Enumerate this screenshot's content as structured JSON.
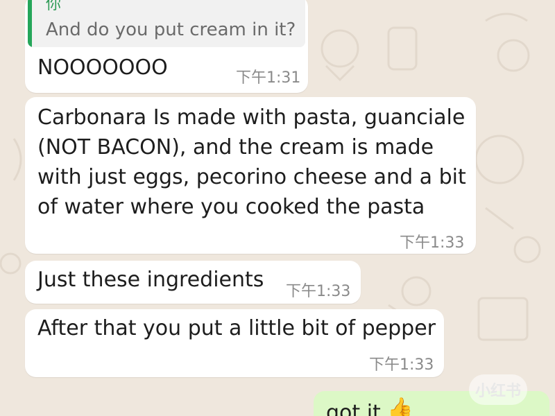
{
  "quoted": {
    "author": "你",
    "text": "And do you put cream in it?"
  },
  "messages": [
    {
      "text": "NOOOOOOO",
      "time": "下午1:31"
    },
    {
      "text": "Carbonara Is made with pasta, guanciale\n(NOT BACON), and the cream is made\nwith just eggs, pecorino cheese and a bit\nof water where you cooked the pasta",
      "time": "下午1:33"
    },
    {
      "text": "Just these ingredients",
      "time": "下午1:33"
    },
    {
      "text": "After that you put a little bit of pepper",
      "time": "下午1:33"
    }
  ],
  "outgoing": {
    "text": "got it"
  },
  "watermark": "小红书",
  "colors": {
    "background": "#efe7dd",
    "incoming_bubble": "#ffffff",
    "outgoing_bubble": "#dcf8c6",
    "quote_accent": "#25a65a"
  },
  "icons": {
    "emoji": "thumbs-up-icon"
  }
}
